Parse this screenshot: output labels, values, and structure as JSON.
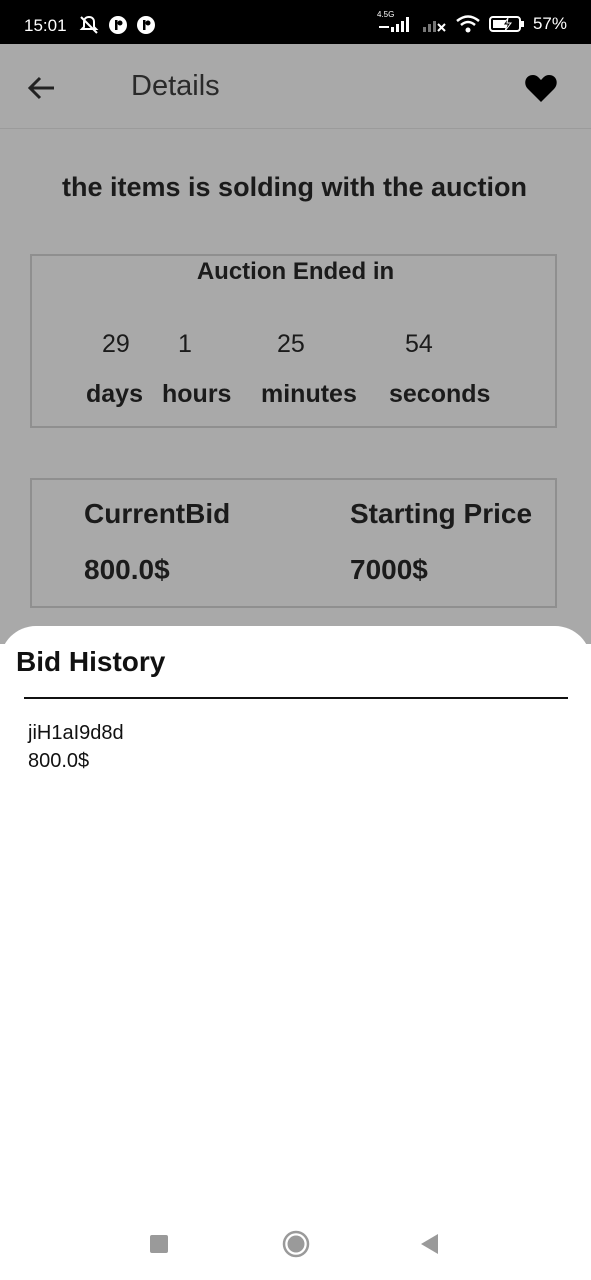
{
  "status_bar": {
    "time": "15:01",
    "network_label": "4.5G",
    "battery_percent": "57%"
  },
  "app_bar": {
    "title": "Details",
    "back_icon": "arrow-left-icon",
    "favorite_icon": "heart-icon"
  },
  "item": {
    "heading": "the items is solding with the auction"
  },
  "auction_timer": {
    "title": "Auction Ended in",
    "days_value": "29",
    "days_label": "days",
    "hours_value": "1",
    "hours_label": "hours",
    "minutes_value": "25",
    "minutes_label": "minutes",
    "seconds_value": "54",
    "seconds_label": "seconds"
  },
  "pricing": {
    "current_bid_label": "CurrentBid",
    "current_bid_value": "800.0$",
    "starting_price_label": "Starting Price",
    "starting_price_value": "7000$"
  },
  "bid_history": {
    "title": "Bid History",
    "entries": [
      {
        "bidder": "jiH1aI9d8d",
        "amount": "800.0$"
      }
    ]
  },
  "colors": {
    "scrim": "#a9a9a9",
    "sheet": "#ffffff",
    "text": "#1b1b1b"
  }
}
